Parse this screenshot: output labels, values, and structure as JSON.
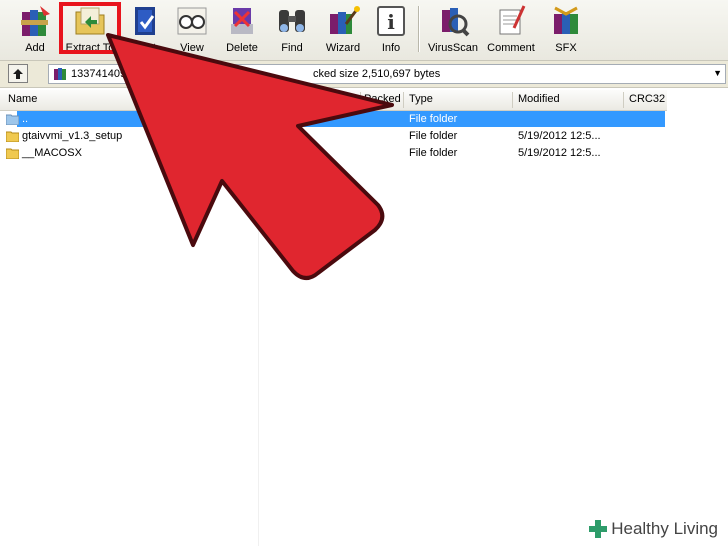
{
  "toolbar": {
    "buttons": [
      {
        "label": "Add",
        "icon": "winrar-books-icon"
      },
      {
        "label": "Extract To",
        "icon": "extract-folder-icon"
      },
      {
        "label": "Test",
        "icon": "test-book-icon"
      },
      {
        "label": "View",
        "icon": "glasses-icon"
      },
      {
        "label": "Delete",
        "icon": "delete-icon"
      },
      {
        "label": "Find",
        "icon": "binoculars-icon"
      },
      {
        "label": "Wizard",
        "icon": "wizard-icon"
      },
      {
        "label": "Info",
        "icon": "info-icon"
      },
      {
        "label": "VirusScan",
        "icon": "virusscan-icon"
      },
      {
        "label": "Comment",
        "icon": "comment-icon"
      },
      {
        "label": "SFX",
        "icon": "sfx-icon"
      }
    ]
  },
  "address": {
    "path_visible": "1337414092",
    "info_visible": "cked size 2,510,697 bytes"
  },
  "columns": {
    "name": "Name",
    "packed": "Packed",
    "type": "Type",
    "modified": "Modified",
    "crc": "CRC32"
  },
  "files": [
    {
      "name": "..",
      "type": "File folder",
      "modified": "",
      "selected": true
    },
    {
      "name": "gtaivvmi_v1.3_setup",
      "type": "File folder",
      "modified": "5/19/2012 12:5..."
    },
    {
      "name": "__MACOSX",
      "type": "File folder",
      "modified": "5/19/2012 12:5..."
    }
  ],
  "watermark": {
    "text": "Healthy Living"
  },
  "colors": {
    "selection": "#3399ff",
    "highlight": "#e8141d",
    "arrow": "#e0262f"
  }
}
